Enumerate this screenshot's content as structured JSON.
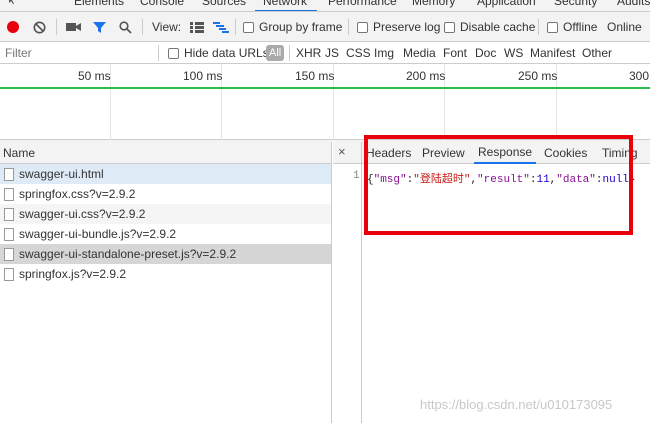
{
  "tabs": [
    "Elements",
    "Console",
    "Sources",
    "Network",
    "Performance",
    "Memory",
    "Application",
    "Security",
    "Audits"
  ],
  "active_tab": "Network",
  "toolbar": {
    "view_label": "View:",
    "group_by_frame": "Group by frame",
    "preserve_log": "Preserve log",
    "disable_cache": "Disable cache",
    "offline": "Offline",
    "online": "Online"
  },
  "filterbar": {
    "filter_placeholder": "Filter",
    "hide_data_urls": "Hide data URLs",
    "all": "All",
    "types": [
      "XHR",
      "JS",
      "CSS",
      "Img",
      "Media",
      "Font",
      "Doc",
      "WS",
      "Manifest",
      "Other"
    ]
  },
  "timeline": {
    "ticks": [
      "50 ms",
      "100 ms",
      "150 ms",
      "200 ms",
      "250 ms",
      "300"
    ]
  },
  "requests": {
    "column_name": "Name",
    "rows": [
      "swagger-ui.html",
      "springfox.css?v=2.9.2",
      "swagger-ui.css?v=2.9.2",
      "swagger-ui-bundle.js?v=2.9.2",
      "swagger-ui-standalone-preset.js?v=2.9.2",
      "springfox.js?v=2.9.2"
    ]
  },
  "details": {
    "close": "×",
    "tabs": [
      "Headers",
      "Preview",
      "Response",
      "Cookies",
      "Timing"
    ],
    "active_tab": "Response",
    "line_number": "1",
    "response": {
      "open": "{",
      "msg_key": "\"msg\"",
      "colon1": ":",
      "msg_val": "\"登陆超时\"",
      "comma1": ",",
      "result_key": "\"result\"",
      "colon2": ":",
      "result_val": "11",
      "comma2": ",",
      "data_key": "\"data\"",
      "colon3": ":",
      "data_val": "null",
      "close": "}"
    }
  },
  "watermark": "https://blog.csdn.net/u010173095"
}
